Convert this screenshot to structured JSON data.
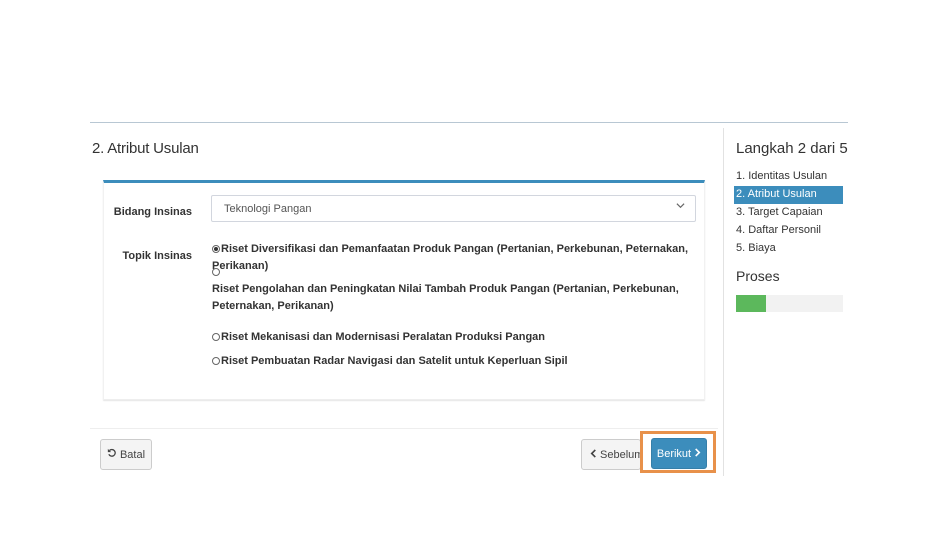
{
  "main": {
    "section_title": "2. Atribut Usulan",
    "bidang_label": "Bidang Insinas",
    "bidang_value": "Teknologi Pangan",
    "topik_label": "Topik Insinas",
    "topik_options": [
      {
        "label": "Riset Diversifikasi dan Pemanfaatan Produk Pangan (Pertanian, Perkebunan, Peternakan, Perikanan)",
        "checked": true
      },
      {
        "label": "Riset Pengolahan dan Peningkatan Nilai Tambah Produk Pangan (Pertanian, Perkebunan, Peternakan, Perikanan)",
        "checked": false
      },
      {
        "label": "Riset Mekanisasi dan Modernisasi Peralatan Produksi Pangan",
        "checked": false
      },
      {
        "label": "Riset Pembuatan Radar Navigasi dan Satelit untuk Keperluan Sipil",
        "checked": false
      }
    ]
  },
  "footer": {
    "batal_label": "Batal",
    "sebelum_label": "Sebelum",
    "berikut_label": "Berikut"
  },
  "sidebar": {
    "title": "Langkah 2 dari 5",
    "steps": [
      "1. Identitas Usulan",
      "2. Atribut Usulan",
      "3. Target Capaian",
      "4. Daftar Personil",
      "5. Biaya"
    ],
    "active_step_index": 1,
    "proses_title": "Proses",
    "progress_fraction": 0.28
  },
  "colors": {
    "accent": "#3c8dbc",
    "progress": "#5cb85c",
    "highlight": "#e8914a"
  },
  "icons": {
    "undo": "undo-icon",
    "chevron_left": "chevron-left-icon",
    "chevron_right": "chevron-right-icon",
    "dropdown": "chevron-down-icon"
  }
}
